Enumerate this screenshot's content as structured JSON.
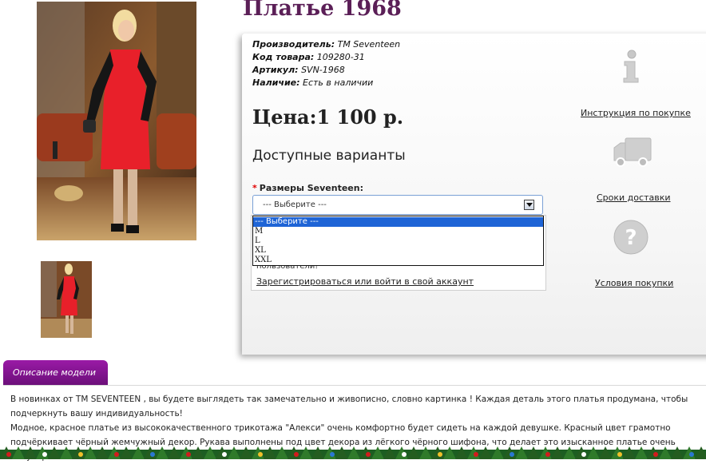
{
  "product": {
    "title": "Платье 1968",
    "meta": [
      {
        "label": "Производитель:",
        "value": "TM Seventeen"
      },
      {
        "label": "Код товара:",
        "value": "109280-31"
      },
      {
        "label": "Артикул:",
        "value": "SVN-1968"
      },
      {
        "label": "Наличие:",
        "value": "Есть в наличии"
      }
    ],
    "price": "Цена:1 100 р.",
    "variants_title": "Доступные варианты",
    "size_label": "Размеры Seventeen:",
    "size_required_mark": "*",
    "size_select_value": "--- Выберите ---",
    "size_options": [
      "--- Выберите ---",
      "M",
      "L",
      "XL",
      "XXL"
    ],
    "login_text": "пользователи!",
    "login_link": "Зарегистрироваться или войти в свой аккаунт"
  },
  "sidebar_links": {
    "instruction": "Инструкция по покупке",
    "delivery": "Сроки доставки",
    "conditions": "Условия покупки"
  },
  "description": {
    "tab_label": "Описание модели",
    "paragraphs": [
      "В новинках от TM SEVENTEEN , вы будете выглядеть так замечательно и живописно, словно картинка ! Каждая деталь этого платья продумана, чтобы подчеркнуть вашу индивидуальность!",
      "Модное, красное платье из высококачественного трикотажа \"Алекси\" очень комфортно будет сидеть на каждой девушке. Красный цвет грамотно подчёркивает чёрный жемчужный декор. Рукава выполнены под цвет декора из лёгкого чёрного шифона, что делает это изысканное платье очень популярным"
    ]
  },
  "colors": {
    "title": "#5b1f57",
    "tab": "#8a169a",
    "dress_red": "#e8202a",
    "select_highlight": "#1e64d6"
  }
}
